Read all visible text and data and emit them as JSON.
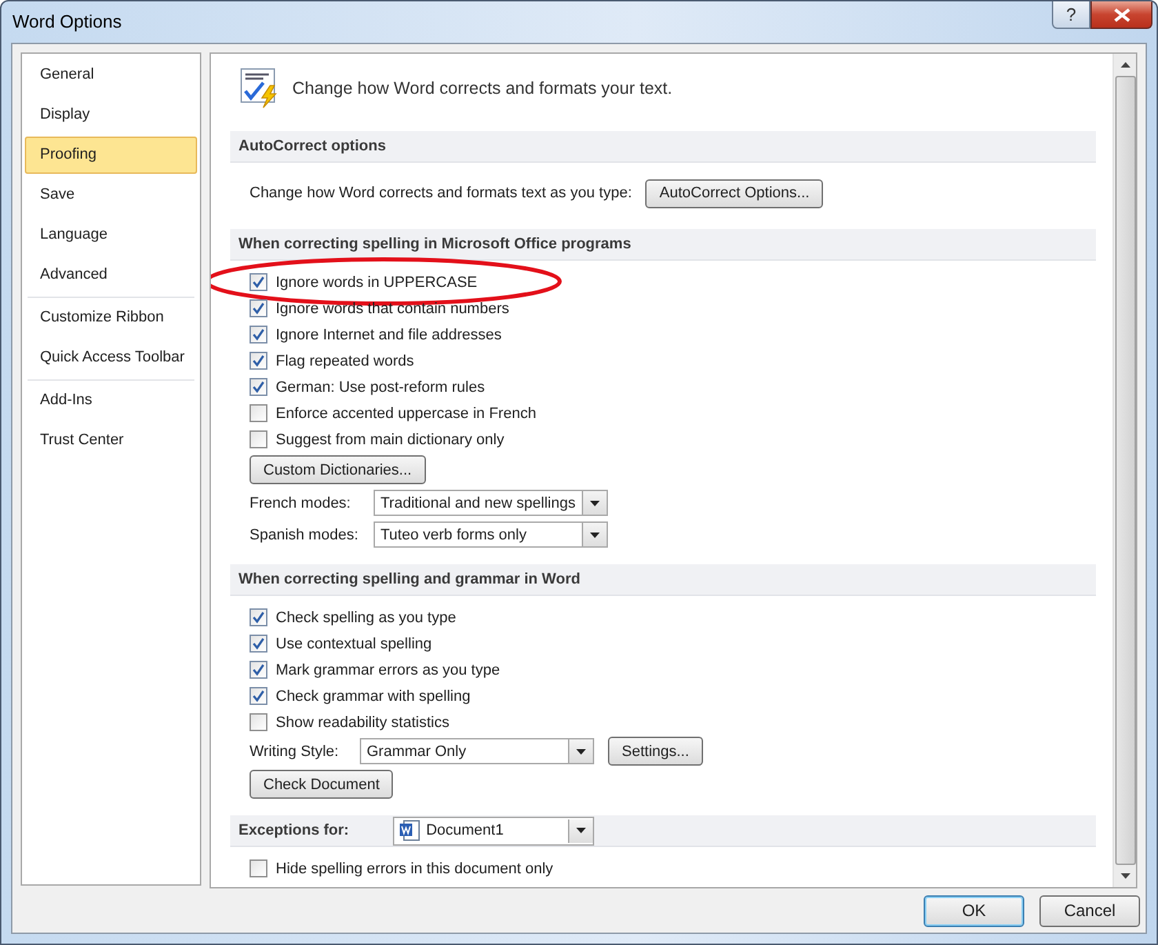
{
  "window": {
    "title": "Word Options",
    "help": "?"
  },
  "sidebar": {
    "groups": [
      {
        "items": [
          {
            "label": "General",
            "selected": false
          },
          {
            "label": "Display",
            "selected": false
          },
          {
            "label": "Proofing",
            "selected": true
          },
          {
            "label": "Save",
            "selected": false
          },
          {
            "label": "Language",
            "selected": false
          },
          {
            "label": "Advanced",
            "selected": false
          }
        ]
      },
      {
        "items": [
          {
            "label": "Customize Ribbon",
            "selected": false
          },
          {
            "label": "Quick Access Toolbar",
            "selected": false
          }
        ]
      },
      {
        "items": [
          {
            "label": "Add-Ins",
            "selected": false
          },
          {
            "label": "Trust Center",
            "selected": false
          }
        ]
      }
    ]
  },
  "header": {
    "text": "Change how Word corrects and formats your text."
  },
  "sections": [
    {
      "title": "AutoCorrect options",
      "rows": [
        {
          "kind": "label-button",
          "label": "Change how Word corrects and formats text as you type:",
          "button": "AutoCorrect Options..."
        }
      ]
    },
    {
      "title": "When correcting spelling in Microsoft Office programs",
      "rows": [
        {
          "kind": "checkbox",
          "label": "Ignore words in UPPERCASE",
          "checked": true,
          "circled": true
        },
        {
          "kind": "checkbox",
          "label": "Ignore words that contain numbers",
          "checked": true
        },
        {
          "kind": "checkbox",
          "label": "Ignore Internet and file addresses",
          "checked": true
        },
        {
          "kind": "checkbox",
          "label": "Flag repeated words",
          "checked": true
        },
        {
          "kind": "checkbox",
          "label": "German: Use post-reform rules",
          "checked": true
        },
        {
          "kind": "checkbox",
          "label": "Enforce accented uppercase in French",
          "checked": false
        },
        {
          "kind": "checkbox",
          "label": "Suggest from main dictionary only",
          "checked": false
        },
        {
          "kind": "button",
          "button": "Custom Dictionaries..."
        },
        {
          "kind": "select",
          "label": "French modes:",
          "value": "Traditional and new spellings"
        },
        {
          "kind": "select",
          "label": "Spanish modes:",
          "value": "Tuteo verb forms only"
        }
      ]
    },
    {
      "title": "When correcting spelling and grammar in Word",
      "rows": [
        {
          "kind": "checkbox",
          "label": "Check spelling as you type",
          "checked": true
        },
        {
          "kind": "checkbox",
          "label": "Use contextual spelling",
          "checked": true
        },
        {
          "kind": "checkbox",
          "label": "Mark grammar errors as you type",
          "checked": true
        },
        {
          "kind": "checkbox",
          "label": "Check grammar with spelling",
          "checked": true
        },
        {
          "kind": "checkbox",
          "label": "Show readability statistics",
          "checked": false
        },
        {
          "kind": "select-button",
          "label": "Writing Style:",
          "value": "Grammar Only",
          "button": "Settings..."
        },
        {
          "kind": "button",
          "button": "Check Document"
        }
      ]
    },
    {
      "title": "Exceptions for:",
      "select": {
        "value": "Document1"
      },
      "rows": [
        {
          "kind": "checkbox",
          "label": "Hide spelling errors in this document only",
          "checked": false
        }
      ]
    }
  ],
  "buttons": [
    {
      "label": "OK",
      "default": true
    },
    {
      "label": "Cancel",
      "default": false
    }
  ]
}
